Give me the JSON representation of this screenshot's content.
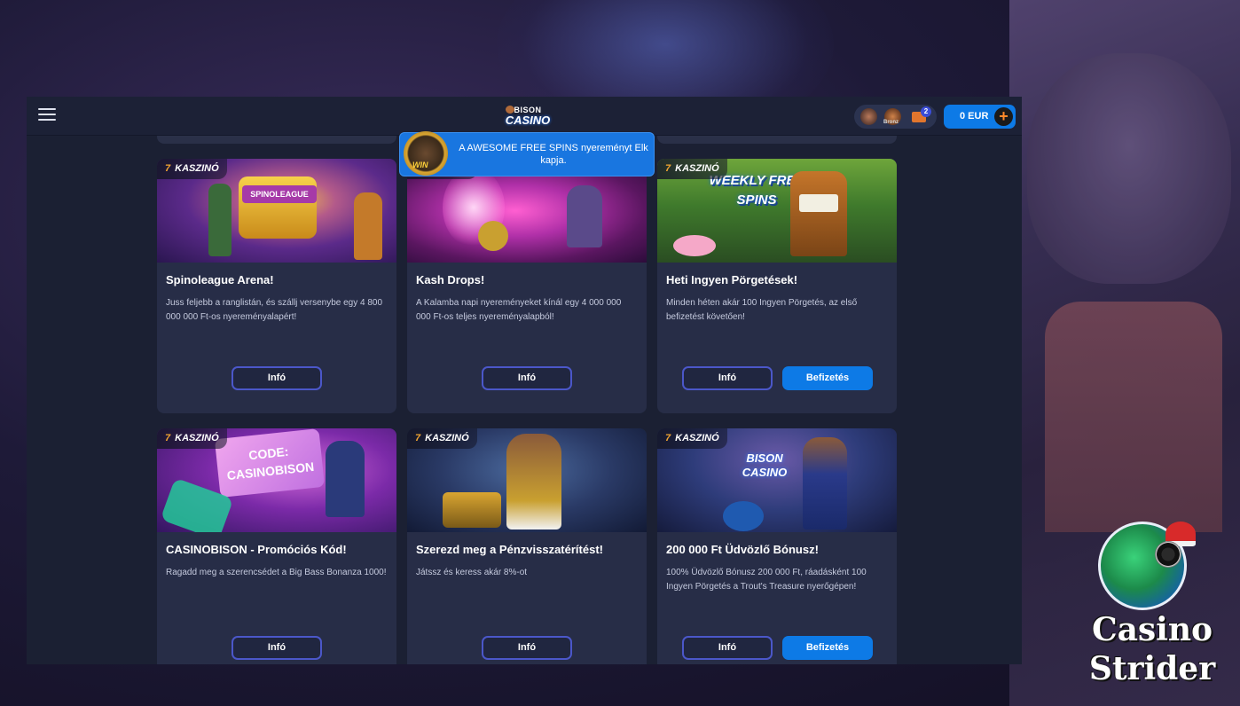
{
  "header": {
    "logo_line1": "BISON",
    "logo_line2": "CASINO",
    "rank_label": "Bronz",
    "mail_count": "2",
    "balance": "0 EUR",
    "add_funds_symbol": "+"
  },
  "notification": {
    "medal_text": "WIN",
    "message": "A AWESOME FREE SPINS nyereményt Elk kapja."
  },
  "badge_number": "7",
  "badge_label": "KASZINÓ",
  "cards": [
    {
      "image_text": "SPINOLEAGUE",
      "title": "Spinoleague Arena!",
      "description": "Juss feljebb a ranglistán, és szállj versenybe egy 4 800 000 000 Ft-os nyereményalapért!",
      "info_label": "Infó"
    },
    {
      "image_text": "",
      "title": "Kash Drops!",
      "description": "A Kalamba napi nyereményeket kínál egy 4 000 000 000 Ft-os teljes nyereményalapból!",
      "info_label": "Infó"
    },
    {
      "image_text": "WEEKLY FREE SPINS",
      "title": "Heti Ingyen Pörgetések!",
      "description": "Minden héten akár 100 Ingyen Pörgetés, az első befizetést követően!",
      "info_label": "Infó",
      "deposit_label": "Befizetés"
    },
    {
      "image_text": "CODE: CASINOBISON",
      "title": "CASINOBISON - Promóciós Kód!",
      "description": "Ragadd meg a szerencsédet a Big Bass Bonanza 1000!",
      "info_label": "Infó"
    },
    {
      "image_text": "",
      "title": "Szerezd meg a Pénzvisszatérítést!",
      "description": "Játssz és keress akár 8%-ot",
      "info_label": "Infó"
    },
    {
      "image_text": "BISON CASINO",
      "title": "200 000 Ft Üdvözlő Bónusz!",
      "description": "100% Üdvözlő Bónusz 200 000 Ft, ráadásként 100 Ingyen Pörgetés a Trout's Treasure nyerőgépen!",
      "info_label": "Infó",
      "deposit_label": "Befizetés"
    }
  ],
  "watermark": {
    "line1": "Casino",
    "line2": "Strider"
  },
  "colors": {
    "accent_blue": "#0d7ae6",
    "card_bg": "#272d47",
    "page_bg": "#1b2033",
    "info_border": "#4b57c9",
    "badge_seven": "#f2a531"
  }
}
